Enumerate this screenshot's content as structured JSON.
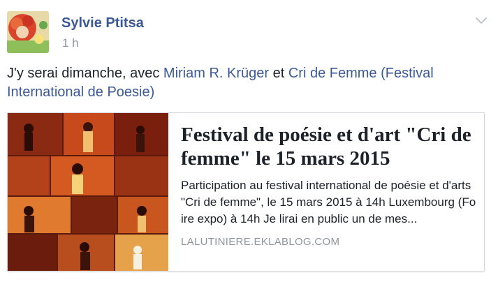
{
  "post": {
    "author": "Sylvie Ptitsa",
    "timestamp": "1 h",
    "message": {
      "text_before": "J'y serai dimanche, avec ",
      "mention1": "Miriam R. Krüger",
      "text_between": " et ",
      "mention2": "Cri de Femme (Festival International de Poesie)"
    },
    "link_card": {
      "title": "Festival de poésie et d'art \"Cri de femme\" le 15 mars 2015",
      "description": "Participation au festival international de poésie et d'arts \"Cri de femme\", le 15 mars 2015 à 14h Luxembourg (Fo ire expo) à 14h Je lirai en public un de mes...",
      "domain": "LALUTINIERE.EKLABLOG.COM"
    }
  },
  "icons": {
    "options": "chevron-down-icon"
  },
  "colors": {
    "link": "#3b5998",
    "meta": "#90949c",
    "text": "#1d2129"
  }
}
